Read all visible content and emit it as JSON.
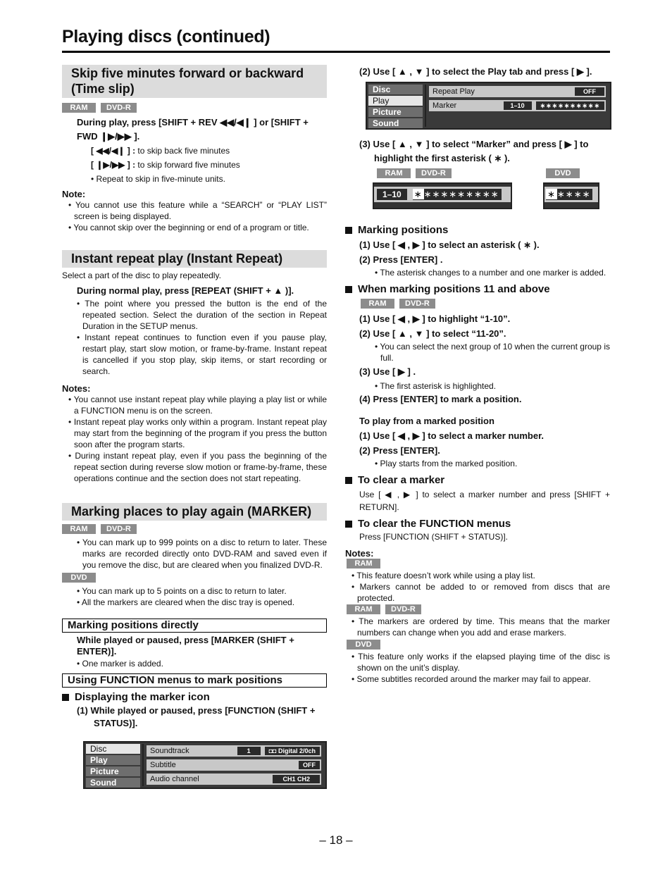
{
  "page": {
    "title": "Playing discs (continued)",
    "page_number": "– 18 –"
  },
  "time_slip": {
    "heading": "Skip five minutes forward or backward (Time slip)",
    "tags": [
      "RAM",
      "DVD-R"
    ],
    "instruction": "During play, press [SHIFT + REV ◀◀/◀❙ ] or [SHIFT + FWD ❙▶/▶▶ ].",
    "back_key": "[ ◀◀/◀❙ ] :",
    "back_text": " to skip back five minutes",
    "fwd_key": "[ ❙▶/▶▶ ] :",
    "fwd_text": " to skip forward five minutes",
    "bullet": "• Repeat to skip in five-minute units.",
    "note_heading": "Note:",
    "notes": [
      "• You cannot use this feature while a “SEARCH” or “PLAY LIST” screen is being displayed.",
      "• You cannot skip over the beginning or end of a program or title."
    ]
  },
  "instant_repeat": {
    "heading": "Instant repeat play (Instant Repeat)",
    "intro": "Select a part of the disc to play repeatedly.",
    "instruction": "During normal play, press [REPEAT (SHIFT + ▲ )].",
    "bullets": [
      "• The point where you pressed the button is the end of the repeated section. Select the duration of the section in Repeat Duration in the SETUP menus.",
      "• Instant repeat continues to function even if you pause play, restart play, start slow motion, or frame-by-frame. Instant repeat is cancelled if you stop play, skip items, or start recording or search."
    ],
    "notes_heading": "Notes:",
    "notes": [
      "• You cannot use instant repeat play while playing a play list or while a FUNCTION menu is on the screen.",
      "• Instant repeat play works only within a program. Instant repeat play may start from the beginning of the program if you press the button soon after the program starts.",
      "• During instant repeat play, even if you pass the beginning of the repeat section during reverse slow motion or frame-by-frame, these operations continue and the section does not start repeating."
    ]
  },
  "marker": {
    "heading": "Marking places to play again (MARKER)",
    "ram_tags": [
      "RAM",
      "DVD-R"
    ],
    "ram_bullets": [
      "• You can mark up to 999 points on a disc to return to later. These marks are recorded directly onto DVD-RAM and saved even if you remove the disc, but are cleared when you finalized DVD-R."
    ],
    "dvd_tag": "DVD",
    "dvd_bullets": [
      "• You can mark up to 5 points on a disc to return to later.",
      "• All the markers are cleared when the disc tray is opened."
    ],
    "direct": {
      "heading": "Marking positions directly",
      "instruction": "While played or paused, press [MARKER (SHIFT + ENTER)].",
      "bullet": "• One marker is added."
    },
    "function": {
      "heading": "Using FUNCTION menus to mark positions",
      "display_heading": "Displaying the marker icon",
      "step1": "(1) While played or paused, press [FUNCTION (SHIFT + STATUS)]."
    }
  },
  "osd_menu_1": {
    "tabs": [
      "Disc",
      "Play",
      "Picture",
      "Sound"
    ],
    "active_tab": 0,
    "rows": [
      {
        "label": "Soundtrack",
        "values": [
          "1",
          "◘◘ Digital 2/0ch"
        ]
      },
      {
        "label": "Subtitle",
        "values": [
          "OFF"
        ]
      },
      {
        "label": "Audio channel",
        "values": [
          "CH1 CH2"
        ]
      }
    ]
  },
  "right": {
    "step2": "(2) Use [ ▲ , ▼ ] to select the Play tab and press [ ▶ ].",
    "step3": "(3) Use [ ▲ , ▼ ] to select “Marker” and press [ ▶ ] to highlight the first asterisk ( ∗ ).",
    "step3_tags_left": [
      "RAM",
      "DVD-R"
    ],
    "step3_tag_right": "DVD",
    "marking_positions": {
      "heading": "Marking positions",
      "step1": "(1) Use [ ◀ , ▶ ]  to select an asterisk ( ∗ ).",
      "step2": "(2) Press [ENTER] .",
      "bullet": "• The asterisk changes to a number and one marker is added."
    },
    "above_11": {
      "heading": "When marking positions 11 and above",
      "tags": [
        "RAM",
        "DVD-R"
      ],
      "step1": "(1) Use [ ◀ , ▶ ] to highlight “1-10”.",
      "step2": "(2) Use [ ▲ , ▼ ] to select “11-20”.",
      "bullet2": "• You can select the next group of 10 when the current group is full.",
      "step3": "(3) Use [ ▶ ] .",
      "bullet3": "• The first asterisk is highlighted.",
      "step4": "(4) Press [ENTER] to mark a position."
    },
    "play_from": {
      "heading": "To play from a marked position",
      "step1": "(1) Use [ ◀ , ▶ ] to select a marker number.",
      "step2": "(2) Press [ENTER].",
      "bullet": "• Play starts from the marked position."
    },
    "clear_marker": {
      "heading": "To clear a marker",
      "text": "Use [ ◀ , ▶ ] to select a marker number and press [SHIFT + RETURN]."
    },
    "clear_function": {
      "heading": "To clear the FUNCTION menus",
      "text": "Press [FUNCTION (SHIFT + STATUS)]."
    },
    "notes": {
      "heading": "Notes:",
      "ram_tag": "RAM",
      "ram_bullets": [
        "• This feature doesn’t work while using a play list.",
        "• Markers cannot be added to or removed from discs that are protected."
      ],
      "ramdvdr_tags": [
        "RAM",
        "DVD-R"
      ],
      "ramdvdr_bullets": [
        "• The markers are ordered by time. This means that the marker numbers can change when you add and erase markers."
      ],
      "dvd_tag": "DVD",
      "dvd_bullets": [
        "• This feature only works if the elapsed playing time of the disc is shown on the unit’s display.",
        "• Some subtitles recorded around the marker may fail to appear."
      ]
    }
  },
  "osd_menu_2": {
    "tabs": [
      "Disc",
      "Play",
      "Picture",
      "Sound"
    ],
    "active_tab": 1,
    "rows": [
      {
        "label": "Repeat Play",
        "values": [
          "OFF"
        ]
      },
      {
        "label": "Marker",
        "values": [
          "1–10",
          "∗∗∗∗∗∗∗∗∗∗"
        ]
      }
    ]
  },
  "marker_strip_ram": {
    "range": "1–10",
    "first": "∗",
    "rest": "∗∗∗∗∗∗∗∗∗"
  },
  "marker_strip_dvd": {
    "first": "∗",
    "rest": "∗∗∗∗"
  }
}
